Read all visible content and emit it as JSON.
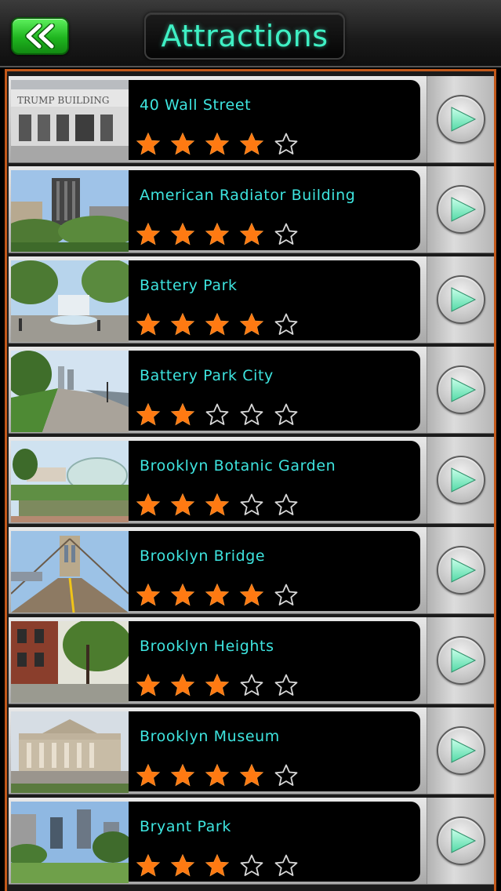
{
  "header": {
    "title": "Attractions",
    "back_icon": "double-chevron-left-icon"
  },
  "colors": {
    "accent_text": "#3ee4df",
    "title_text": "#3ff0c4",
    "star_filled": "#ff7a12",
    "list_border": "#c2581a",
    "back_button": "#1fb51f"
  },
  "attractions": [
    {
      "name": "40 Wall Street",
      "rating": 4,
      "max_rating": 5,
      "thumb": "building-facade"
    },
    {
      "name": "American Radiator Building",
      "rating": 4,
      "max_rating": 5,
      "thumb": "skyline-trees"
    },
    {
      "name": "Battery Park",
      "rating": 4,
      "max_rating": 5,
      "thumb": "park-fountain"
    },
    {
      "name": "Battery Park City",
      "rating": 2,
      "max_rating": 5,
      "thumb": "waterfront-path"
    },
    {
      "name": "Brooklyn Botanic Garden",
      "rating": 3,
      "max_rating": 5,
      "thumb": "greenhouse-pond"
    },
    {
      "name": "Brooklyn Bridge",
      "rating": 4,
      "max_rating": 5,
      "thumb": "bridge-walkway"
    },
    {
      "name": "Brooklyn Heights",
      "rating": 3,
      "max_rating": 5,
      "thumb": "brownstone-street"
    },
    {
      "name": "Brooklyn Museum",
      "rating": 4,
      "max_rating": 5,
      "thumb": "museum-facade"
    },
    {
      "name": "Bryant Park",
      "rating": 3,
      "max_rating": 5,
      "thumb": "park-lawn-skyline"
    }
  ],
  "row_action_icon": "play-arrow-icon"
}
